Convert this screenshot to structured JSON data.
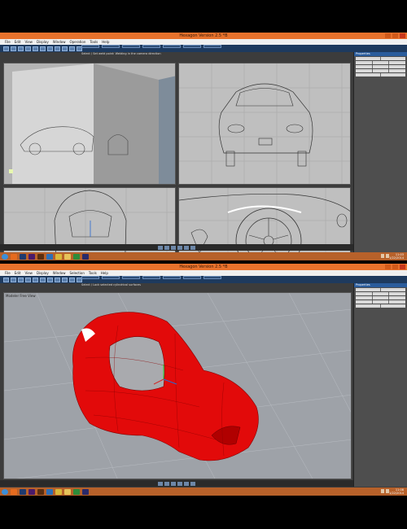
{
  "frame1": {
    "title": "Hexagon Version 2.5 *B",
    "menu": [
      "File",
      "Edit",
      "View",
      "Display",
      "Window",
      "Operation",
      "Tools",
      "Help"
    ],
    "status": "Select / Set weld point: Welding in the camera direction",
    "panel_title": "Properties",
    "clock_time": "11:03",
    "clock_date": "1/22/2014"
  },
  "frame2": {
    "title": "Hexagon Version 2.5 *B",
    "menu": [
      "File",
      "Edit",
      "View",
      "Display",
      "Window",
      "Selection",
      "Tools",
      "Help"
    ],
    "status": "Select / Lock selected cylindrical surfaces",
    "viewport_label": "Modeler Free View",
    "panel_title": "Properties",
    "clock_time": "11:08",
    "clock_date": "1/22/2014"
  },
  "colors": {
    "titlebar": "#e8722c",
    "taskbar": "#b7612a",
    "body": "#e20a0a",
    "toolbar": "#1e3a5e"
  },
  "taskbar_icons": [
    "start-orb-icon",
    "firefox-icon",
    "photoshop-icon",
    "premiere-icon",
    "illustrator-icon",
    "hexagon-icon",
    "chrome-icon",
    "folder-icon",
    "daz-icon",
    "media-icon"
  ]
}
